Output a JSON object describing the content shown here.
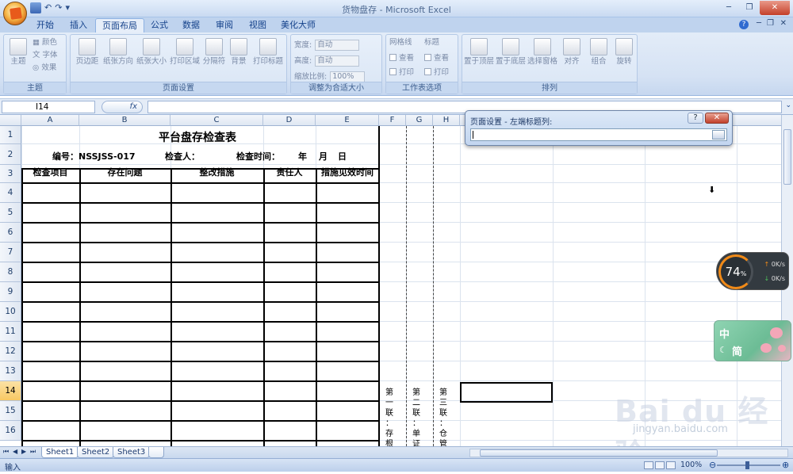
{
  "window": {
    "title": "货物盘存 - Microsoft Excel"
  },
  "qat": {
    "undo": "↶",
    "redo": "↷",
    "more": "▾"
  },
  "tabs": [
    "开始",
    "插入",
    "页面布局",
    "公式",
    "数据",
    "审阅",
    "视图",
    "美化大师"
  ],
  "ribbon": {
    "groups": [
      {
        "label": "主题",
        "items": [
          "主题"
        ],
        "small": [
          "颜色",
          "字体",
          "效果"
        ]
      },
      {
        "label": "页面设置",
        "items": [
          "页边距",
          "纸张方向",
          "纸张大小",
          "打印区域",
          "分隔符",
          "背景",
          "打印标题"
        ]
      },
      {
        "label": "调整为合适大小",
        "width_label": "宽度:",
        "height_label": "高度:",
        "scale_label": "缩放比例:",
        "width_value": "自动",
        "height_value": "自动",
        "scale_value": "100%"
      },
      {
        "label": "工作表选项",
        "gridlines": "网格线",
        "headings": "标题",
        "view": "查看",
        "print": "打印"
      },
      {
        "label": "排列",
        "items": [
          "置于顶层",
          "置于底层",
          "选择窗格",
          "对齐",
          "组合",
          "旋转"
        ]
      }
    ]
  },
  "formula_bar": {
    "cell_ref": "I14",
    "fx": "fx",
    "value": ""
  },
  "columns": [
    "A",
    "B",
    "C",
    "D",
    "E",
    "F",
    "G",
    "H"
  ],
  "rows": [
    "1",
    "2",
    "3",
    "4",
    "5",
    "6",
    "7",
    "8",
    "9",
    "10",
    "11",
    "12",
    "13",
    "14",
    "15",
    "16"
  ],
  "selected_cell": "I14",
  "sheet": {
    "title": "平台盘存检查表",
    "code_label": "编号：NSSJSS-017",
    "inspector_label": "检查人：",
    "time_label": "检查时间：",
    "year": "年",
    "month": "月",
    "day": "日",
    "headers": [
      "检查项目",
      "存在问题",
      "整改措施",
      "责任人",
      "措施见效时间"
    ],
    "side_f": "第一联：存根",
    "side_g": "第二联：单证",
    "side_h": "第三联：仓管"
  },
  "dialog": {
    "title": "页面设置 - 左端标题列:",
    "help": "?",
    "close": "✕",
    "value": ""
  },
  "widget": {
    "percent": "74",
    "percent_unit": "%",
    "up": "0K/s",
    "down": "0K/s"
  },
  "ime": {
    "lang": "中",
    "mode": "简"
  },
  "sheets": [
    "Sheet1",
    "Sheet2",
    "Sheet3"
  ],
  "status": {
    "mode": "输入",
    "zoom": "100%"
  },
  "watermark": {
    "text": "Bai du 经验",
    "url": "jingyan.baidu.com"
  }
}
